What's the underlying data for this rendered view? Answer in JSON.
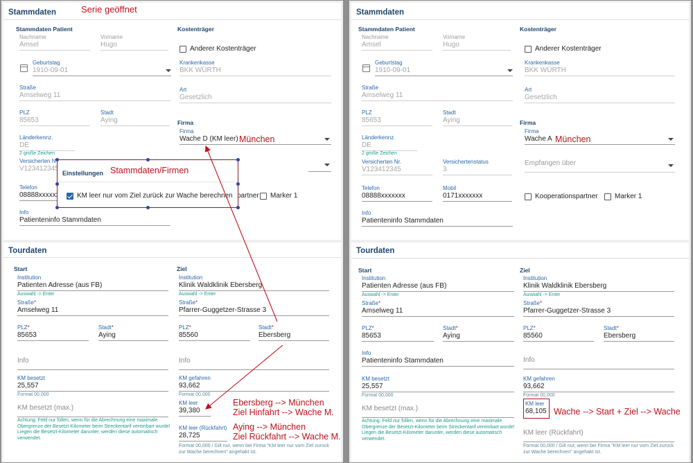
{
  "left": {
    "annotation_title": "Serie geöffnet",
    "stamm": {
      "title": "Stammdaten",
      "patient_head": "Stammdaten Patient",
      "nachname": {
        "label": "Nachname",
        "value": "Amsel"
      },
      "vorname": {
        "label": "Vorname",
        "value": "Hugo"
      },
      "geburtstag": {
        "label": "Geburtstag",
        "value": "1910-09-01"
      },
      "strasse": {
        "label": "Straße",
        "value": "Amselweg 11"
      },
      "plz": {
        "label": "PLZ",
        "value": "85653"
      },
      "stadt": {
        "label": "Stadt",
        "value": "Aying"
      },
      "laender": {
        "label": "Länderkennz.",
        "value": "DE",
        "hint": "2 große Zeichen"
      },
      "versicherten": {
        "label": "Versicherten N",
        "value": "V123412345"
      },
      "telefon": {
        "label": "Telefon",
        "value": "08888xxxxxxxx"
      },
      "info": {
        "label": "Info",
        "value": "Patienteninfo Stammdaten"
      },
      "kosten_head": "Kostenträger",
      "anderer": "Anderer Kostenträger",
      "krankenkasse": {
        "label": "Krankenkasse",
        "value": "BKK WÜRTH"
      },
      "art": {
        "label": "Art",
        "value": "Gesetzlich"
      },
      "firma_head": "Firma",
      "firma": {
        "label": "Firma",
        "value": "Wache D (KM leer)"
      },
      "firma_annotation": "München",
      "partner_partial": "partner",
      "marker": "Marker 1"
    },
    "popup": {
      "title": "Einstellungen",
      "annotation": "Stammdaten/Firmen",
      "checkbox": "KM leer nur vom Ziel zurück zur Wache berechnen"
    },
    "tour": {
      "title": "Tourdaten",
      "start_head": "Start",
      "ziel_head": "Ziel",
      "start_inst": {
        "label": "Institution",
        "value": "Patienten Adresse (aus FB)",
        "hint": "Auswahl -> Enter"
      },
      "ziel_inst": {
        "label": "Institution",
        "value": "Klinik Waldklinik Ebersberg",
        "hint": "Auswahl -> Enter"
      },
      "start_strasse": {
        "label": "Straße",
        "value": "Amselweg 11"
      },
      "ziel_strasse": {
        "label": "Straße",
        "value": "Pfarrer-Guggetzer-Strasse 3"
      },
      "start_plz": {
        "label": "PLZ",
        "value": "85653"
      },
      "start_stadt": {
        "label": "Stadt",
        "value": "Aying"
      },
      "ziel_plz": {
        "label": "PLZ",
        "value": "85560"
      },
      "ziel_stadt": {
        "label": "Stadt",
        "value": "Ebersberg"
      },
      "start_info": "Info",
      "ziel_info": "Info",
      "km_besetzt": {
        "label": "KM besetzt",
        "value": "25,557",
        "hint": "Format 00,000"
      },
      "km_gefahren": {
        "label": "KM gefahren",
        "value": "93,662",
        "hint": "Format 00,000"
      },
      "km_besetzt_max": "KM besetzt (max.)",
      "km_leer": {
        "label": "KM leer",
        "value": "39,380"
      },
      "km_leer_rueck": {
        "label": "KM leer (Rückfahrt)",
        "value": "28,725"
      },
      "achtung": "Achtung: Feld nur füllen, wenn für die Abrechnung eine maximale Obergrenze der Besetzt-Kilometer beim Streckentarif vereinbart wurde! Liegen die Besetzt-Kilometer darunter, werden diese automatisch verwendet.",
      "rueck_hint": "Format 00,000 / Gilt nur, wenn bei Firma \"KM leer nur vom Ziel zurück zur Wache berechnen\" angehakt ist.",
      "ann_hin_1": "Ebersberg --> München",
      "ann_hin_2": "Ziel Hinfahrt --> Wache M.",
      "ann_rueck_1": "Aying --> München",
      "ann_rueck_2": "Ziel Rückfahrt --> Wache M."
    }
  },
  "right": {
    "stamm": {
      "title": "Stammdaten",
      "patient_head": "Stammdaten Patient",
      "nachname": {
        "label": "Nachname",
        "value": "Amsel"
      },
      "vorname": {
        "label": "Vorname",
        "value": "Hugo"
      },
      "geburtstag": {
        "label": "Geburtstag",
        "value": "1910-09-01"
      },
      "strasse": {
        "label": "Straße",
        "value": "Amselweg 11"
      },
      "plz": {
        "label": "PLZ",
        "value": "85653"
      },
      "stadt": {
        "label": "Stadt",
        "value": "Aying"
      },
      "laender": {
        "label": "Länderkennz.",
        "value": "DE",
        "hint": "2 große Zeichen"
      },
      "versicherten": {
        "label": "Versicherten Nr.",
        "value": "V123412345"
      },
      "versstatus": {
        "label": "Versichertenstatus",
        "value": "3"
      },
      "telefon": {
        "label": "Telefon",
        "value": "08888xxxxxxx"
      },
      "mobil": {
        "label": "Mobil",
        "value": "0171xxxxxxx"
      },
      "info": {
        "label": "Info",
        "value": "Patienteninfo Stammdaten"
      },
      "kosten_head": "Kostenträger",
      "anderer": "Anderer Kostenträger",
      "krankenkasse": {
        "label": "Krankenkasse",
        "value": "BKK WÜRTH"
      },
      "art": {
        "label": "Art",
        "value": "Gesetzlich"
      },
      "firma_head": "Firma",
      "firma": {
        "label": "Firma",
        "value": "Wache A"
      },
      "firma_annotation": "München",
      "empfangen": "Empfangen über",
      "kooperation": "Kooperationspartner",
      "marker": "Marker 1"
    },
    "tour": {
      "title": "Tourdaten",
      "start_head": "Start",
      "ziel_head": "Ziel",
      "start_inst": {
        "label": "Institution",
        "value": "Patienten Adresse (aus FB)",
        "hint": "Auswahl -> Enter"
      },
      "ziel_inst": {
        "label": "Institution",
        "value": "Klinik Waldklinik Ebersberg",
        "hint": "Auswahl -> Enter"
      },
      "start_strasse": {
        "label": "Straße",
        "value": "Amselweg 11"
      },
      "ziel_strasse": {
        "label": "Straße",
        "value": "Pfarrer-Guggetzer-Strasse 3"
      },
      "start_plz": {
        "label": "PLZ",
        "value": "85653"
      },
      "start_stadt": {
        "label": "Stadt",
        "value": "Aying"
      },
      "ziel_plz": {
        "label": "PLZ",
        "value": "85560"
      },
      "ziel_stadt": {
        "label": "Stadt",
        "value": "Ebersberg"
      },
      "start_info": {
        "label": "Info",
        "value": "Patienteninfo Stammdaten"
      },
      "ziel_info": "Info",
      "km_besetzt": {
        "label": "KM besetzt",
        "value": "25,557",
        "hint": "Format 00,000"
      },
      "km_gefahren": {
        "label": "KM gefahren",
        "value": "93,662",
        "hint": "Format 00,000"
      },
      "km_besetzt_max": "KM besetzt (max.)",
      "km_leer": {
        "label": "KM leer",
        "value": "68,105"
      },
      "km_leer_annotation": "Wache --> Start + Ziel --> Wache",
      "km_leer_rueck": "KM leer (Rückfahrt)",
      "achtung": "Achtung: Feld nur füllen, wenn für die Abrechnung eine maximale Obergrenze der Besetzt-Kilometer beim Streckentarif vereinbart wurde! Liegen die Besetzt-Kilometer darunter, werden diese automatisch verwendet.",
      "rueck_hint": "Format 00,000 / Gilt nur, wenn bei Firma \"KM leer nur vom Ziel zurück zur Wache berechnen\" angehakt ist."
    }
  }
}
